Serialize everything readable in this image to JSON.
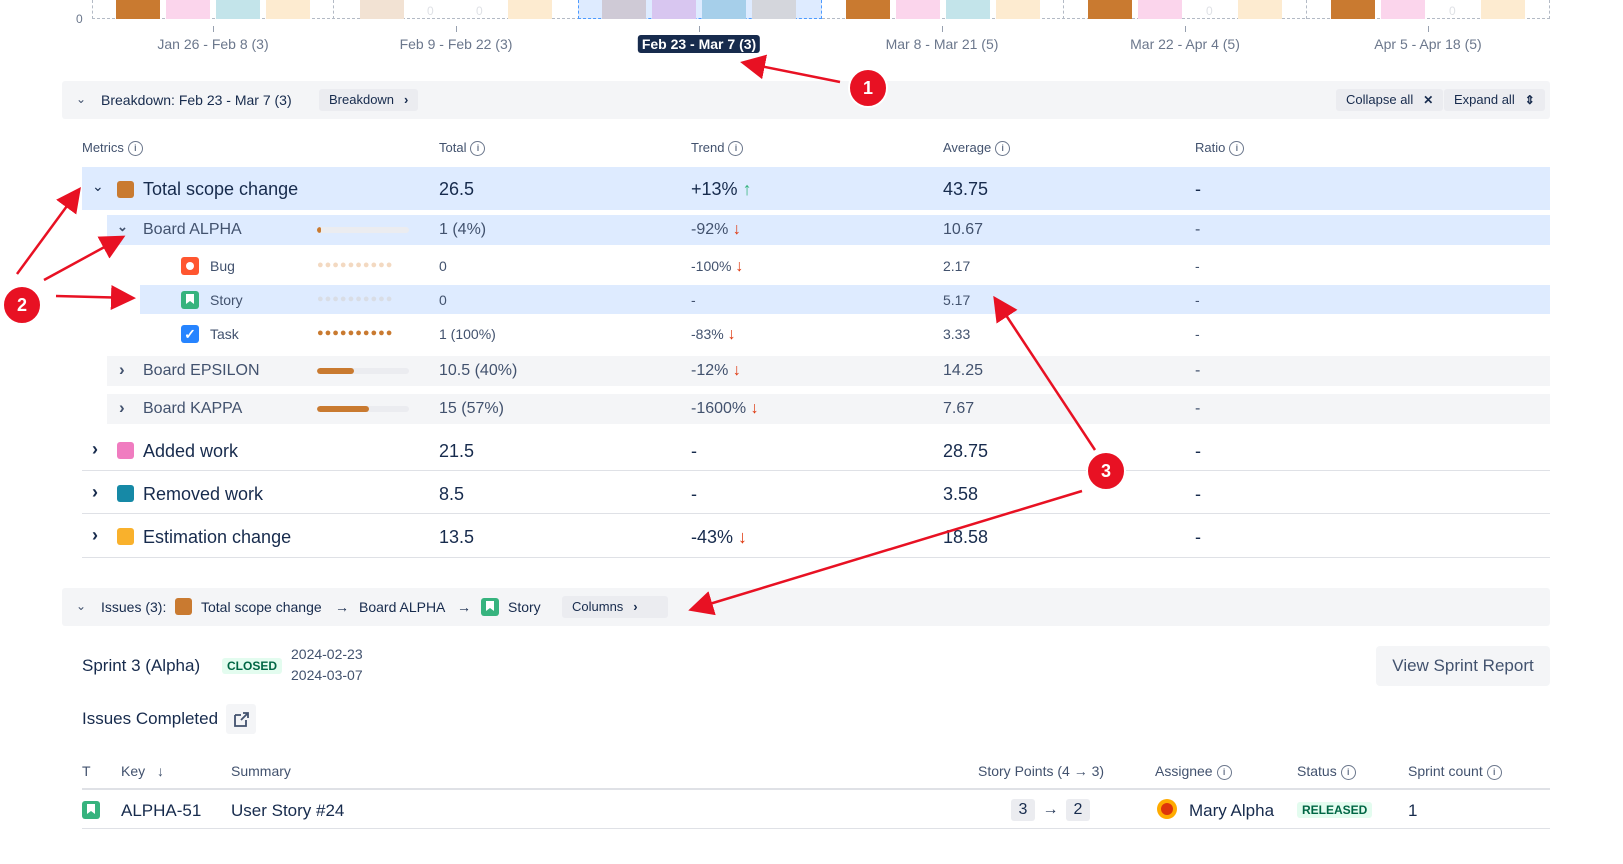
{
  "chart_strip": {
    "zero_label": "0",
    "inner_zero_label": "0",
    "periods": [
      {
        "label": "Jan 26 - Feb 8 (3)",
        "selected": false
      },
      {
        "label": "Feb 9 - Feb 22 (3)",
        "selected": false
      },
      {
        "label": "Feb 23 - Mar 7 (3)",
        "selected": true
      },
      {
        "label": "Mar 8 - Mar 21 (5)",
        "selected": false
      },
      {
        "label": "Mar 22 - Apr 4 (5)",
        "selected": false
      },
      {
        "label": "Apr 5 - Apr 18 (5)",
        "selected": false
      }
    ],
    "colors": {
      "total": "#c97a30",
      "added": "#f9c9e6",
      "removed": "#b8e0e8",
      "estimation": "#fde9c9"
    }
  },
  "breakdown": {
    "title": "Breakdown: Feb 23 - Mar 7 (3)",
    "breakdown_button": "Breakdown",
    "collapse_all": "Collapse all",
    "expand_all": "Expand all",
    "columns": {
      "metrics": "Metrics",
      "total": "Total",
      "trend": "Trend",
      "average": "Average",
      "ratio": "Ratio"
    },
    "rows": [
      {
        "name": "Total scope change",
        "total": "26.5",
        "trend": "+13%",
        "trend_dir": "up",
        "average": "43.75",
        "ratio": "-",
        "color": "#c97a30"
      },
      {
        "name": "Board ALPHA",
        "total": "1 (4%)",
        "trend": "-92%",
        "trend_dir": "down",
        "average": "10.67",
        "ratio": "-",
        "progress": 0.04
      },
      {
        "name": "Bug",
        "total": "0",
        "trend": "-100%",
        "trend_dir": "down",
        "average": "2.17",
        "ratio": "-",
        "icon": "bug-icon"
      },
      {
        "name": "Story",
        "total": "0",
        "trend": "-",
        "trend_dir": "none",
        "average": "5.17",
        "ratio": "-",
        "icon": "story-icon"
      },
      {
        "name": "Task",
        "total": "1 (100%)",
        "trend": "-83%",
        "trend_dir": "down",
        "average": "3.33",
        "ratio": "-",
        "icon": "task-icon",
        "progress": 1.0
      },
      {
        "name": "Board EPSILON",
        "total": "10.5 (40%)",
        "trend": "-12%",
        "trend_dir": "down",
        "average": "14.25",
        "ratio": "-",
        "progress": 0.4
      },
      {
        "name": "Board KAPPA",
        "total": "15 (57%)",
        "trend": "-1600%",
        "trend_dir": "down",
        "average": "7.67",
        "ratio": "-",
        "progress": 0.57
      },
      {
        "name": "Added work",
        "total": "21.5",
        "trend": "-",
        "trend_dir": "none",
        "average": "28.75",
        "ratio": "-",
        "color": "#f07cc0"
      },
      {
        "name": "Removed work",
        "total": "8.5",
        "trend": "-",
        "trend_dir": "none",
        "average": "3.58",
        "ratio": "-",
        "color": "#1689a6"
      },
      {
        "name": "Estimation change",
        "total": "13.5",
        "trend": "-43%",
        "trend_dir": "down",
        "average": "18.58",
        "ratio": "-",
        "color": "#f9b12c"
      }
    ],
    "arrows": {
      "up": "↑",
      "down": "↓"
    }
  },
  "issues": {
    "prefix": "Issues (3):",
    "crumb_1": "Total scope change",
    "crumb_2": "Board ALPHA",
    "crumb_3": "Story",
    "arrow": "→",
    "columns_button": "Columns",
    "sprint_name": "Sprint 3 (Alpha)",
    "sprint_status": "CLOSED",
    "sprint_start": "2024-02-23",
    "sprint_end": "2024-03-07",
    "view_report": "View Sprint Report",
    "completed_title": "Issues Completed",
    "table_headers": {
      "type": "T",
      "key": "Key",
      "summary": "Summary",
      "story_points": "Story Points (4 → 3)",
      "assignee": "Assignee",
      "status": "Status",
      "sprint_count": "Sprint count"
    },
    "rows": [
      {
        "key": "ALPHA-51",
        "summary": "User Story #24",
        "sp_from": "3",
        "sp_to": "2",
        "assignee": "Mary Alpha",
        "status": "RELEASED",
        "sprint_count": "1"
      }
    ]
  },
  "annotations": [
    "1",
    "2",
    "3"
  ]
}
